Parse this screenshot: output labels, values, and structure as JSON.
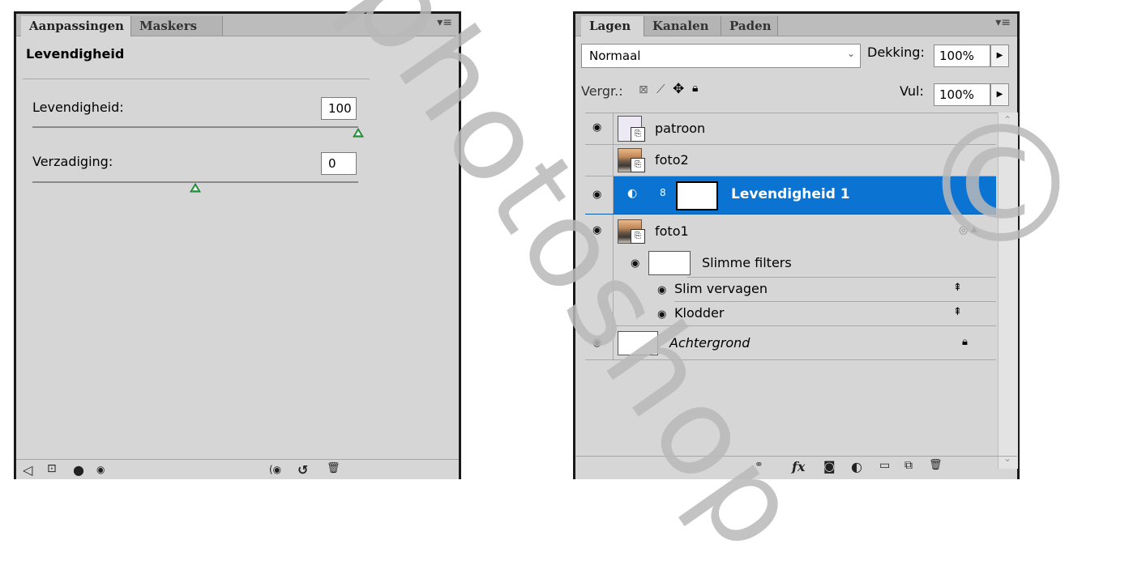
{
  "adjustments_panel": {
    "tabs": [
      "Aanpassingen",
      "Maskers"
    ],
    "title": "Levendigheid",
    "vibrance_label": "Levendigheid:",
    "vibrance_value": "100",
    "vibrance_slider": 1.0,
    "saturation_label": "Verzadiging:",
    "saturation_value": "0",
    "saturation_slider": 0.5,
    "bottom_icons": [
      "back-arrow-icon",
      "expand-view-icon",
      "clip-to-layer-icon",
      "visibility-eye-icon",
      "view-previous-state-icon",
      "reset-icon",
      "trash-icon"
    ]
  },
  "layers_panel": {
    "tabs": [
      "Lagen",
      "Kanalen",
      "Paden"
    ],
    "blend_mode": "Normaal",
    "opacity_label": "Dekking:",
    "opacity_value": "100%",
    "lock_label": "Vergr.:",
    "fill_label": "Vul:",
    "fill_value": "100%",
    "layers": [
      {
        "name": "patroon",
        "visible": true
      },
      {
        "name": "foto2",
        "visible": false
      },
      {
        "name": "Levendigheid 1",
        "visible": true,
        "selected": true
      },
      {
        "name": "foto1",
        "visible": true
      },
      {
        "name": "Slimme filters",
        "visible": true
      },
      {
        "name": "Slim vervagen",
        "visible": true
      },
      {
        "name": "Klodder",
        "visible": true
      },
      {
        "name": "Achtergrond",
        "visible": true
      }
    ],
    "bottom_icons": [
      "link-icon",
      "fx-icon",
      "add-mask-icon",
      "adjustment-layer-icon",
      "group-folder-icon",
      "new-layer-icon",
      "trash-icon"
    ],
    "fx_label": "fx"
  },
  "watermark": {
    "text": "photoshop",
    "copyright": "©"
  }
}
